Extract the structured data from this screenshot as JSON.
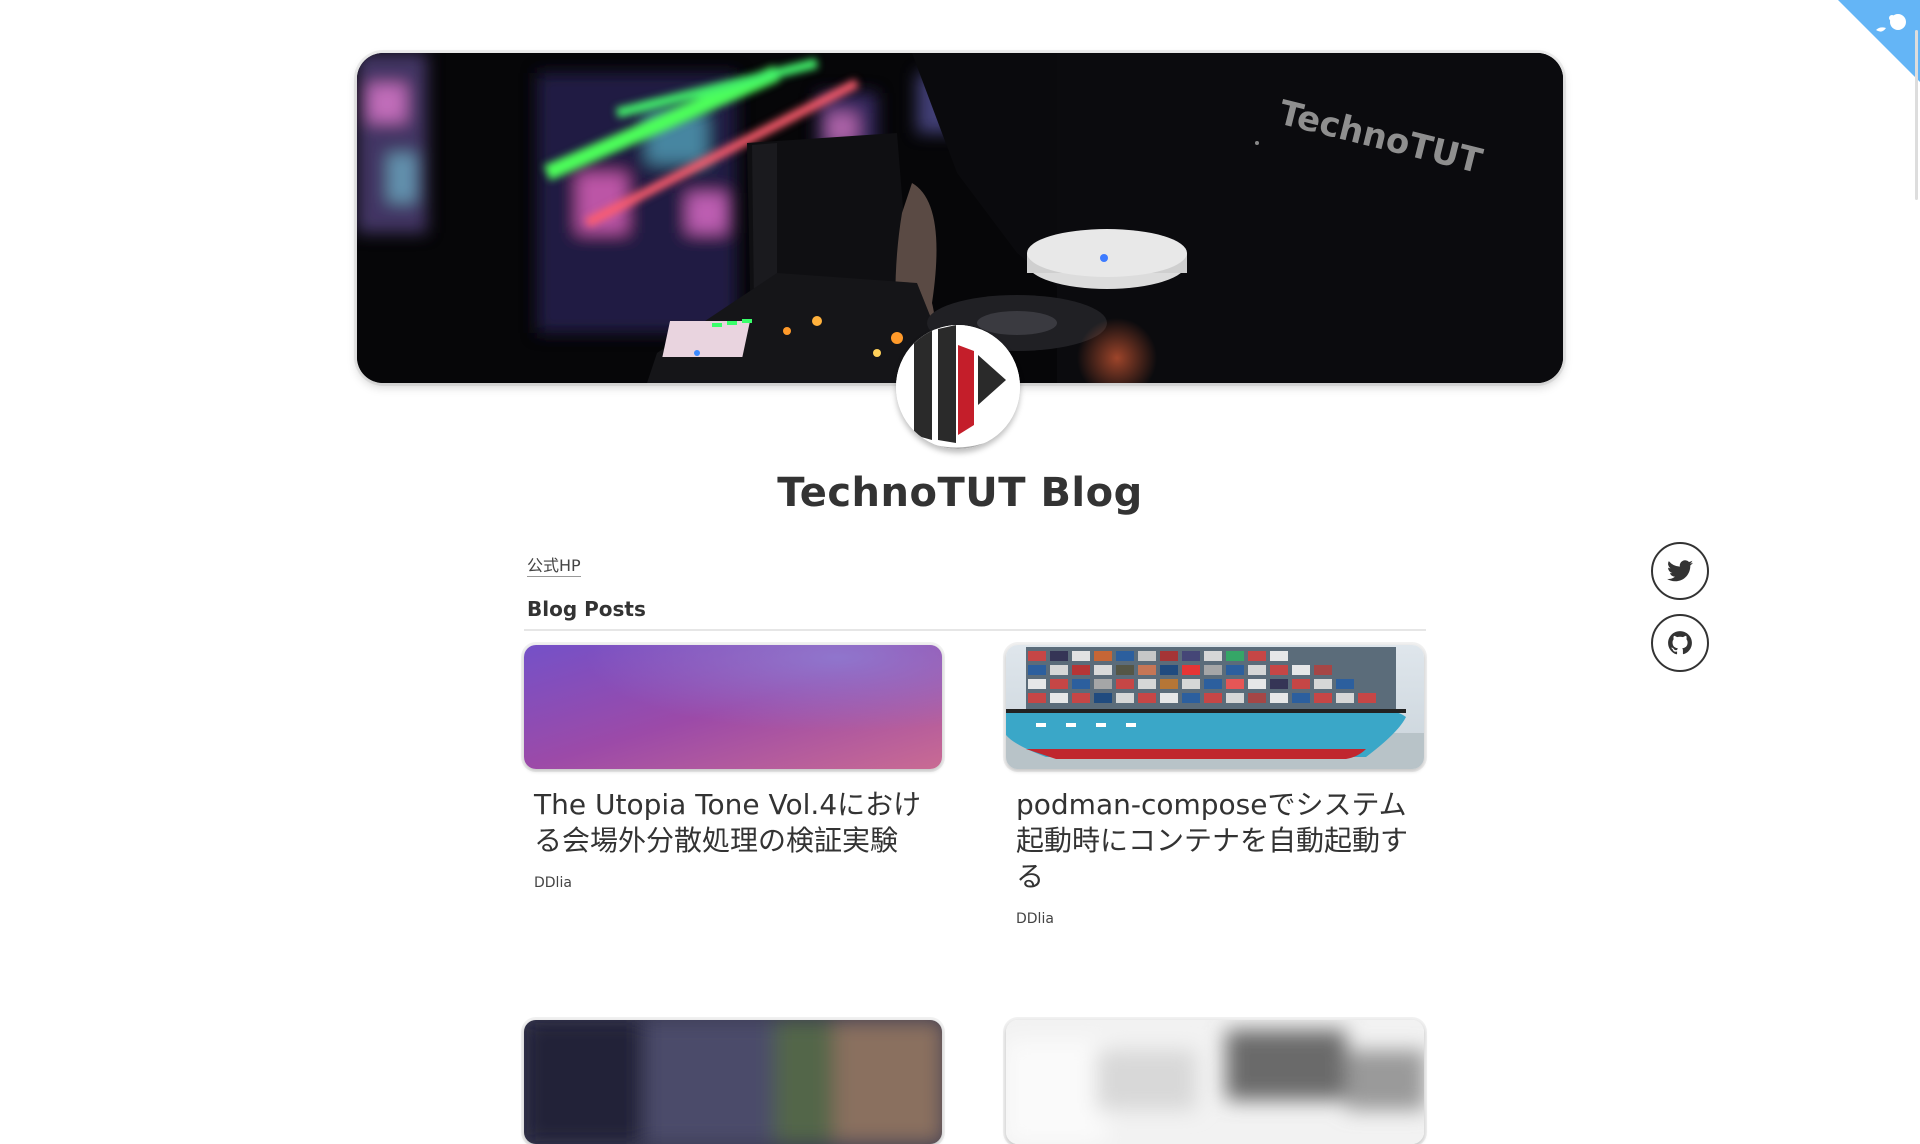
{
  "site": {
    "title": "TechnoTUT Blog",
    "nav_link": "公式HP"
  },
  "hero": {
    "image": "DJ performing at mixer under colorful projected lights",
    "shirt_text": "TechnoTUT"
  },
  "avatar": {
    "icon": "technotut-logo-icon"
  },
  "section": {
    "title": "Blog Posts"
  },
  "posts": [
    {
      "title": "The Utopia Tone Vol.4における会場外分散処理の検証実験",
      "author": "DDlia",
      "cover": "purple-gradient"
    },
    {
      "title": "podman-composeでシステム起動時にコンテナを自動起動する",
      "author": "DDlia",
      "cover": "container-ship-photo"
    },
    {
      "title": "",
      "author": "",
      "cover": "blurred-dark-photo"
    },
    {
      "title": "",
      "author": "",
      "cover": "blurred-light-photo"
    }
  ],
  "social": [
    {
      "name": "twitter",
      "icon": "twitter-icon"
    },
    {
      "name": "github",
      "icon": "github-icon"
    }
  ],
  "colors": {
    "accent_corner": "#64b5f6",
    "text": "#333333"
  }
}
